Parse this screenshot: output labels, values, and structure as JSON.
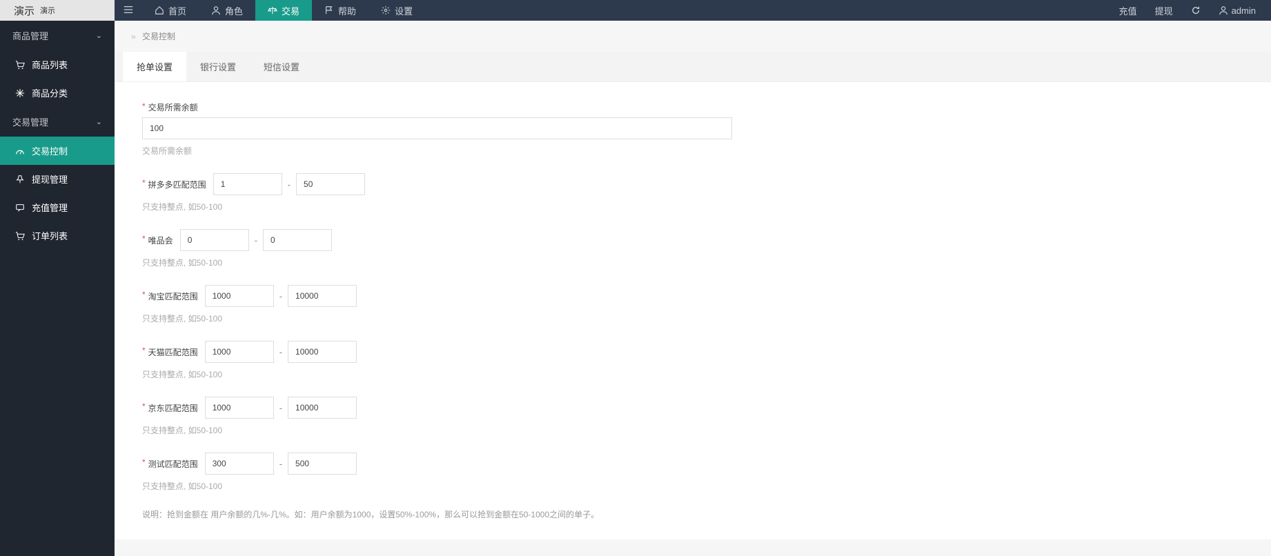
{
  "brand": {
    "title": "演示",
    "suffix": "演示"
  },
  "topnav": {
    "items": [
      {
        "label": "首页"
      },
      {
        "label": "角色"
      },
      {
        "label": "交易"
      },
      {
        "label": "帮助"
      },
      {
        "label": "设置"
      }
    ],
    "right": {
      "recharge": "充值",
      "withdraw": "提现",
      "user": "admin"
    }
  },
  "sidebar": {
    "groups": [
      {
        "title": "商品管理",
        "items": [
          {
            "label": "商品列表"
          },
          {
            "label": "商品分类"
          }
        ]
      },
      {
        "title": "交易管理",
        "items": [
          {
            "label": "交易控制",
            "active": true
          },
          {
            "label": "提现管理"
          },
          {
            "label": "充值管理"
          },
          {
            "label": "订单列表"
          }
        ]
      }
    ]
  },
  "breadcrumb": {
    "sep": "»",
    "current": "交易控制"
  },
  "tabs": [
    {
      "label": "抢单设置",
      "active": true
    },
    {
      "label": "银行设置"
    },
    {
      "label": "短信设置"
    }
  ],
  "form": {
    "balance": {
      "label": "交易所需余额",
      "value": "100",
      "hint": "交易所需余额"
    },
    "ranges": [
      {
        "label": "拼多多匹配范围",
        "min": "1",
        "max": "50",
        "hint": "只支持整点, 如50-100"
      },
      {
        "label": "唯品会",
        "min": "0",
        "max": "0",
        "hint": "只支持整点, 如50-100"
      },
      {
        "label": "淘宝匹配范围",
        "min": "1000",
        "max": "10000",
        "hint": "只支持整点, 如50-100"
      },
      {
        "label": "天猫匹配范围",
        "min": "1000",
        "max": "10000",
        "hint": "只支持整点, 如50-100"
      },
      {
        "label": "京东匹配范围",
        "min": "1000",
        "max": "10000",
        "hint": "只支持整点, 如50-100"
      },
      {
        "label": "测试匹配范围",
        "min": "300",
        "max": "500",
        "hint": "只支持整点, 如50-100"
      }
    ],
    "description": "说明：抢到金额在 用户余额的几%-几%。如：用户余额为1000，设置50%-100%，那么可以抢到金额在50-1000之间的单子。"
  },
  "asterisk": "*"
}
